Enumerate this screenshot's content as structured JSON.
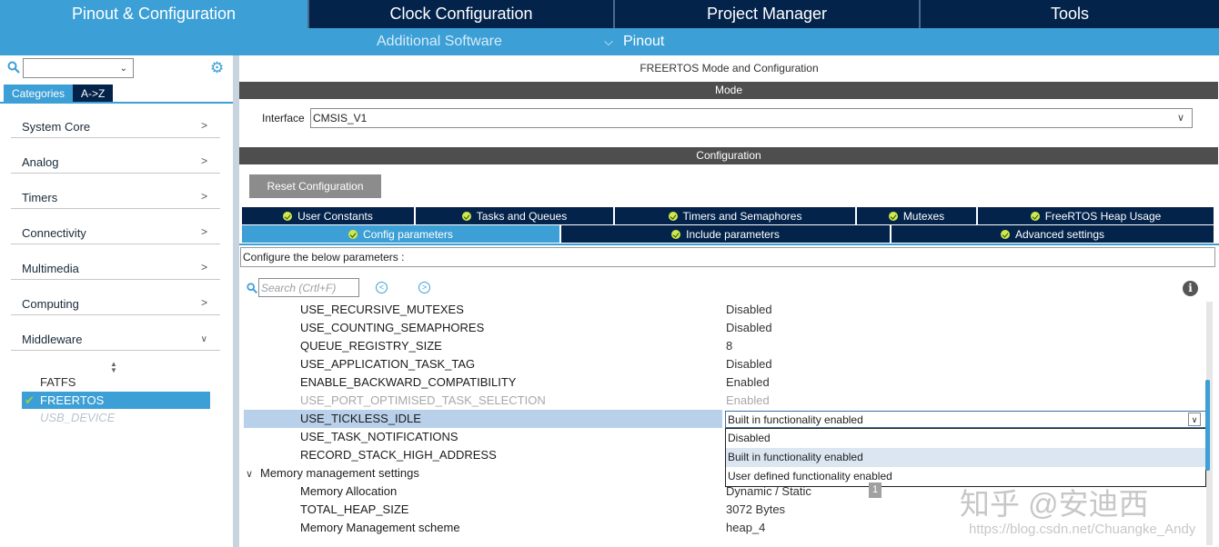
{
  "top_tabs": [
    "Pinout & Configuration",
    "Clock Configuration",
    "Project Manager",
    "Tools"
  ],
  "subbar": {
    "additional_software": "Additional Software",
    "pinout": "Pinout"
  },
  "sidebar": {
    "tabs": [
      "Categories",
      "A->Z"
    ],
    "categories": [
      "System Core",
      "Analog",
      "Timers",
      "Connectivity",
      "Multimedia",
      "Computing",
      "Middleware"
    ],
    "middleware_items": [
      "FATFS",
      "FREERTOS",
      "USB_DEVICE"
    ]
  },
  "main": {
    "title": "FREERTOS Mode and Configuration",
    "mode_bar": "Mode",
    "interface_label": "Interface",
    "interface_value": "CMSIS_V1",
    "config_bar": "Configuration",
    "reset_button": "Reset Configuration",
    "tabs_row1": [
      "User Constants",
      "Tasks and Queues",
      "Timers and Semaphores",
      "Mutexes",
      "FreeRTOS Heap Usage"
    ],
    "tabs_row2": [
      "Config parameters",
      "Include parameters",
      "Advanced settings"
    ],
    "hint": "Configure the below parameters :",
    "search_placeholder": "Search (Crtl+F)",
    "params": [
      {
        "name": "USE_RECURSIVE_MUTEXES",
        "value": "Disabled"
      },
      {
        "name": "USE_COUNTING_SEMAPHORES",
        "value": "Disabled"
      },
      {
        "name": "QUEUE_REGISTRY_SIZE",
        "value": "8"
      },
      {
        "name": "USE_APPLICATION_TASK_TAG",
        "value": "Disabled"
      },
      {
        "name": "ENABLE_BACKWARD_COMPATIBILITY",
        "value": "Enabled"
      },
      {
        "name": "USE_PORT_OPTIMISED_TASK_SELECTION",
        "value": "Enabled"
      },
      {
        "name": "USE_TICKLESS_IDLE",
        "value": "Built in functionality enabled"
      },
      {
        "name": "USE_TASK_NOTIFICATIONS",
        "value": ""
      },
      {
        "name": "RECORD_STACK_HIGH_ADDRESS",
        "value": ""
      }
    ],
    "group_memory": "Memory management settings",
    "memory_params": [
      {
        "name": "Memory Allocation",
        "value": "Dynamic / Static"
      },
      {
        "name": "TOTAL_HEAP_SIZE",
        "value": "3072 Bytes"
      },
      {
        "name": "Memory Management scheme",
        "value": "heap_4"
      }
    ],
    "dropdown_options": [
      "Disabled",
      "Built in functionality enabled",
      "User defined functionality enabled"
    ],
    "tooltip": "1"
  },
  "watermark": {
    "line1": "知乎 @安迪西",
    "line2": "https://blog.csdn.net/Chuangke_Andy"
  }
}
